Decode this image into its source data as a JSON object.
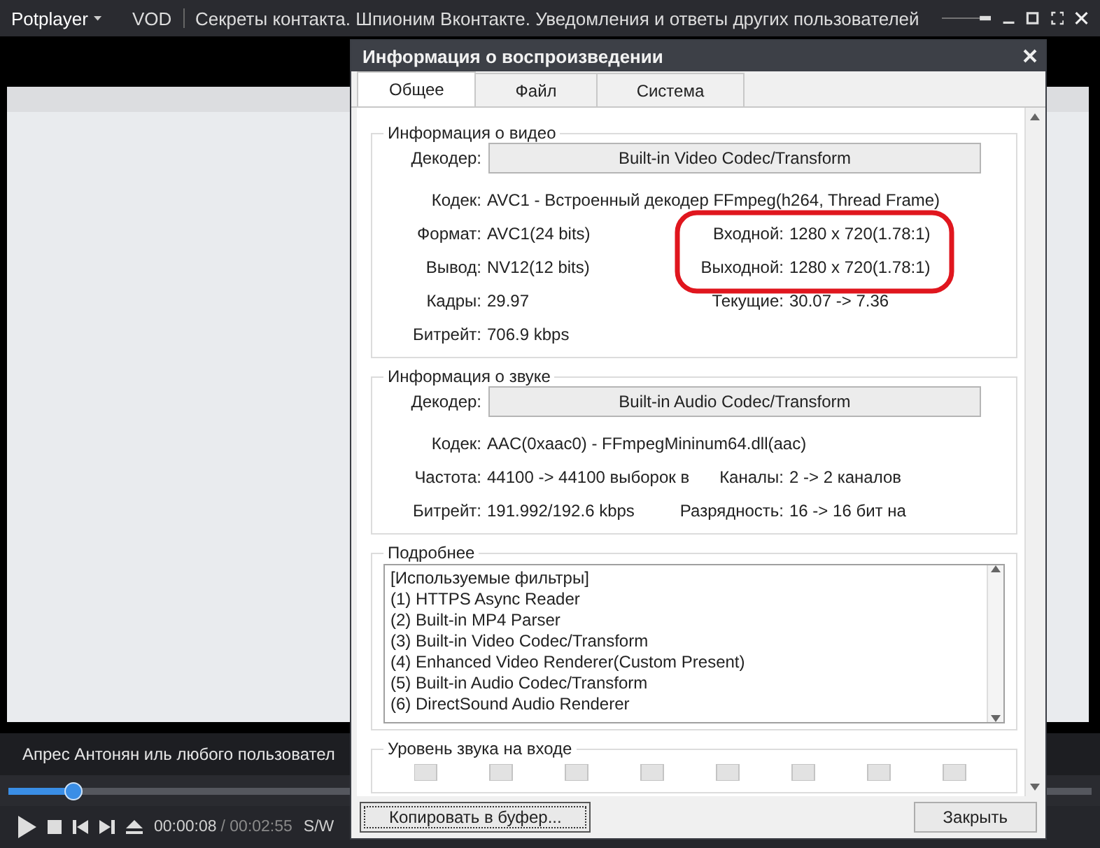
{
  "player": {
    "brand": "Potplayer",
    "mode": "VOD",
    "title": "Секреты контакта. Шпионим Вконтакте. Уведомления и ответы других пользователей",
    "subtitle": "Апрес Антонян иль любого пользовател",
    "seek": {
      "level": 0.06
    },
    "time_current": "00:00:08",
    "time_total": "/ 00:02:55",
    "audio_mode": "S/W"
  },
  "dialog": {
    "title": "Информация о воспроизведении",
    "tabs": [
      {
        "label": "Общее",
        "selected": true
      },
      {
        "label": "Файл",
        "selected": false
      },
      {
        "label": "Система",
        "selected": false
      }
    ],
    "video": {
      "legend": "Информация о видео",
      "decoder_label": "Декодер:",
      "decoder": "Built-in Video Codec/Transform",
      "codec": {
        "label": "Кодек:",
        "value": "AVC1 - Встроенный декодер FFmpeg(h264, Thread Frame)"
      },
      "rows": [
        {
          "left": {
            "label": "Формат:",
            "value": "AVC1(24 bits)"
          },
          "right": {
            "label": "Входной:",
            "value": "1280 x 720(1.78:1)"
          }
        },
        {
          "left": {
            "label": "Вывод:",
            "value": "NV12(12 bits)"
          },
          "right": {
            "label": "Выходной:",
            "value": "1280 x 720(1.78:1)"
          }
        },
        {
          "left": {
            "label": "Кадры:",
            "value": "29.97"
          },
          "right": {
            "label": "Текущие:",
            "value": "30.07 -> 7.36"
          }
        },
        {
          "left": {
            "label": "Битрейт:",
            "value": "706.9 kbps"
          }
        }
      ]
    },
    "audio": {
      "legend": "Информация о звуке",
      "decoder_label": "Декодер:",
      "decoder": "Built-in Audio Codec/Transform",
      "codec": {
        "label": "Кодек:",
        "value": "AAC(0xaac0) - FFmpegMininum64.dll(aac)"
      },
      "rows": [
        {
          "left": {
            "label": "Частота:",
            "value": "44100 -> 44100 выборок в"
          },
          "right": {
            "label": "Каналы:",
            "value": "2 -> 2 каналов"
          }
        },
        {
          "left": {
            "label": "Битрейт:",
            "value": "191.992/192.6 kbps"
          },
          "right": {
            "label": "Разрядность:",
            "value": "16 -> 16 бит на"
          }
        }
      ]
    },
    "details": {
      "legend": "Подробнее",
      "lines": [
        "[Используемые фильтры]",
        "(1) HTTPS Async Reader",
        "(2) Built-in MP4 Parser",
        "(3) Built-in Video Codec/Transform",
        "(4) Enhanced Video Renderer(Custom Present)",
        "(5) Built-in Audio Codec/Transform",
        "(6) DirectSound Audio Renderer"
      ]
    },
    "level": {
      "legend": "Уровень звука на входе"
    },
    "buttons": [
      "Копировать в буфер...",
      "Закрыть"
    ]
  }
}
